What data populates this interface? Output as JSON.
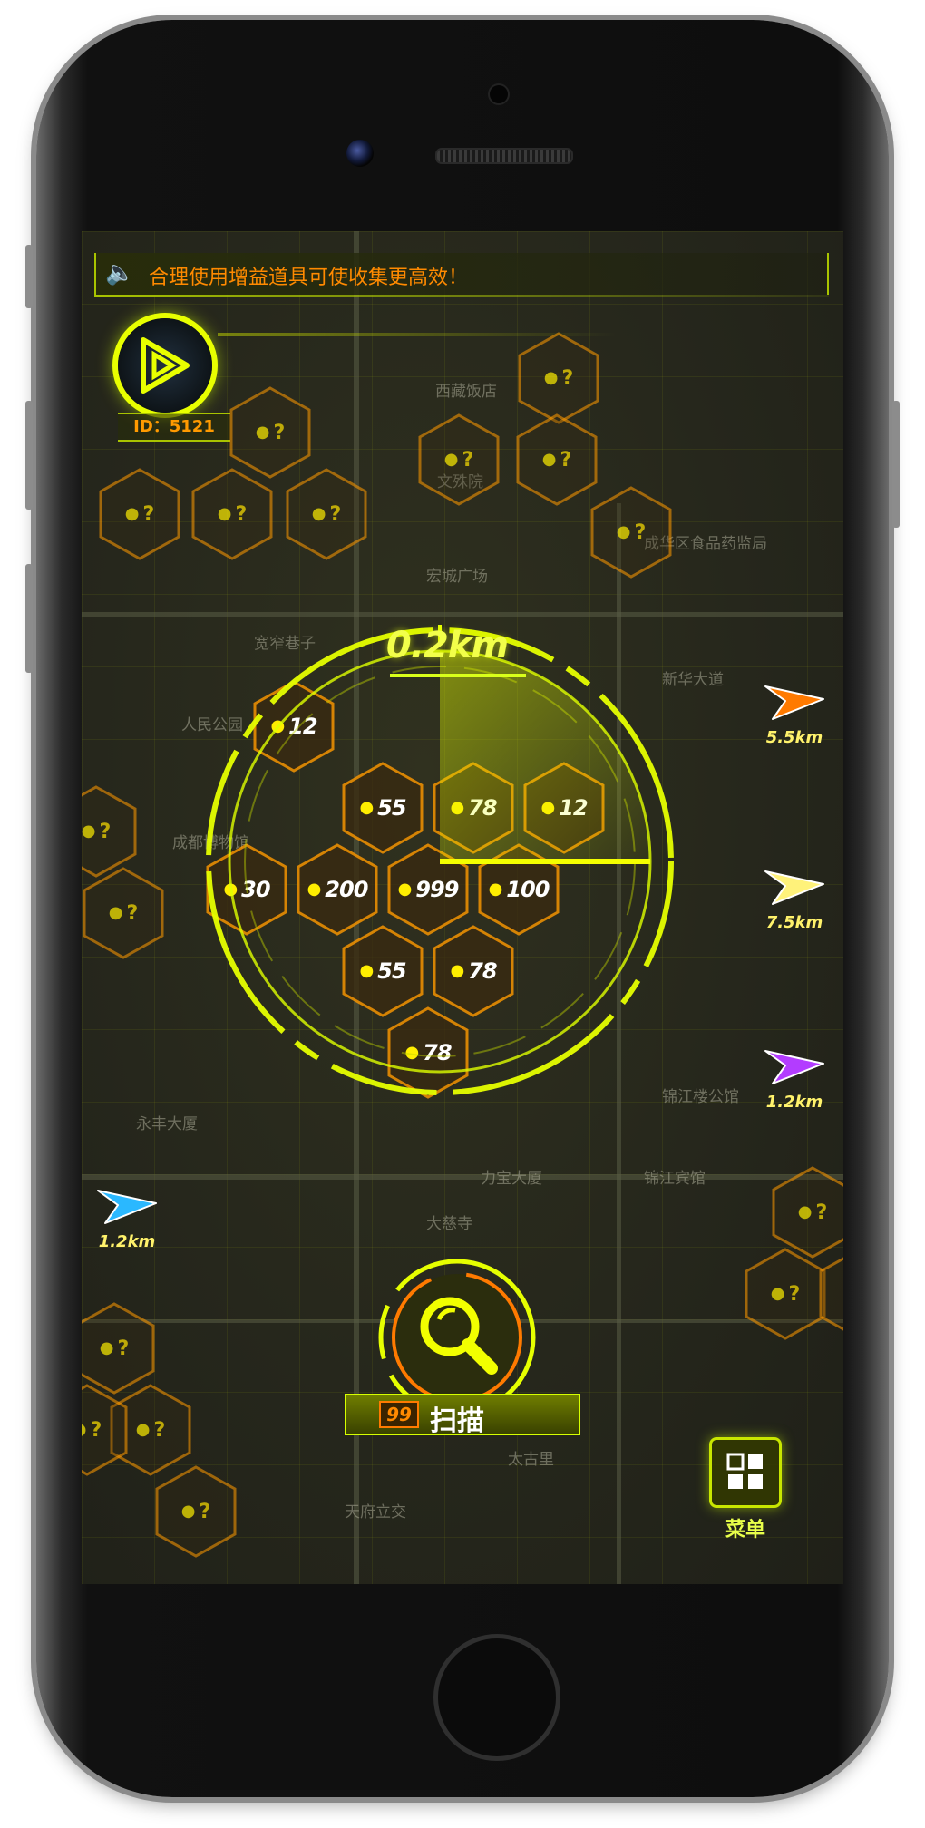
{
  "banner": {
    "message": "合理使用增益道具可使收集更高效！",
    "speaker_icon": "speaker-icon"
  },
  "player": {
    "id_text": "ID：5121"
  },
  "radar": {
    "distance": "0.2km",
    "cells": [
      "12",
      "55",
      "78",
      "12",
      "30",
      "200",
      "999",
      "100",
      "55",
      "78",
      "78"
    ]
  },
  "unknown_cell_text": "?",
  "markers": [
    {
      "distance": "5.5km",
      "color": "#ff7a00"
    },
    {
      "distance": "7.5km",
      "color": "#fff27a"
    },
    {
      "distance": "1.2km",
      "color": "#b33cff"
    },
    {
      "distance": "1.2km",
      "color": "#2ab8ff"
    }
  ],
  "map_labels": [
    "西藏饭店",
    "文殊院",
    "成华区食品药监局",
    "宽窄巷子",
    "人民公园",
    "成都博物馆",
    "宏城广场",
    "新华大道",
    "锦江楼公馆",
    "永丰大厦",
    "力宝大厦",
    "锦江宾馆",
    "大慈寺",
    "天府立交",
    "太古里"
  ],
  "scan": {
    "count": "99",
    "label": "扫描"
  },
  "menu": {
    "label": "菜单"
  },
  "colors": {
    "accent": "#e6ff00",
    "orange": "#ff8a00",
    "hex_fill": "#3a2a10"
  }
}
